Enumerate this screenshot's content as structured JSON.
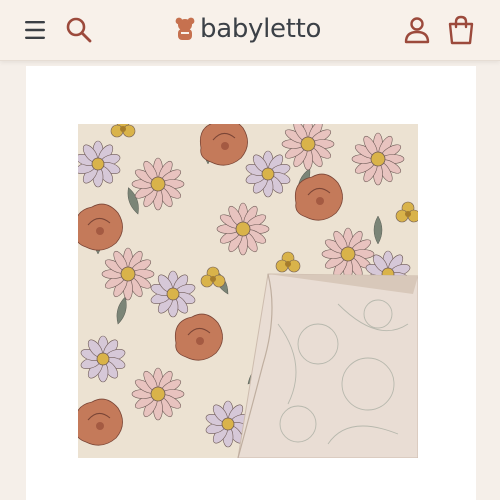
{
  "header": {
    "brand": "babyletto",
    "icons": [
      "menu-icon",
      "search-icon",
      "account-icon",
      "cart-icon"
    ]
  },
  "colors": {
    "accent": "#9c4a3c",
    "header_bg": "#f8f1ea",
    "page_bg": "#f5efe9",
    "brand_text": "#3c4147",
    "fabric_bg": "#ece2d2",
    "flower_rust": "#c47a5a",
    "flower_pink": "#e8c3bf",
    "flower_lilac": "#d6c8d8",
    "flower_mustard": "#d9b34a"
  },
  "product": {
    "image": "floral-muslin-swaddle-blanket"
  }
}
